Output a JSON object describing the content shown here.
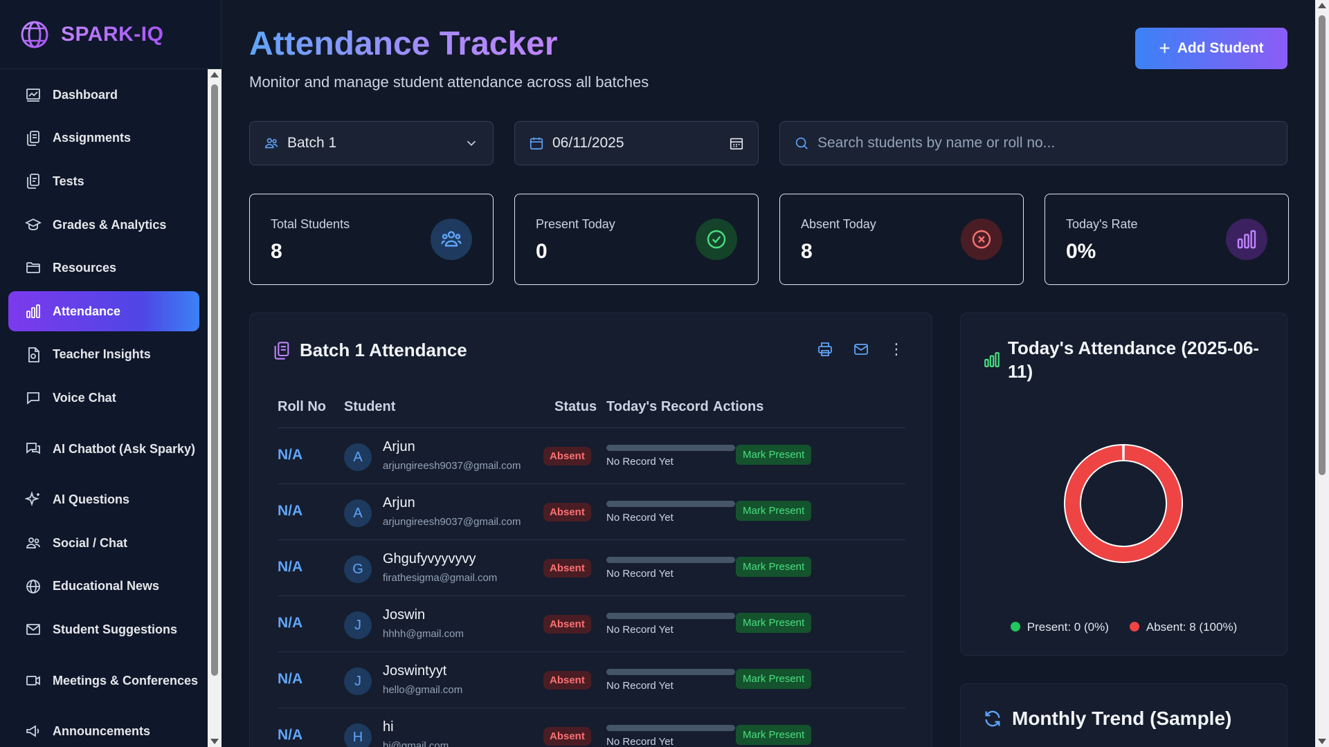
{
  "brand": {
    "name": "SPARK-IQ"
  },
  "sidebar": {
    "items": [
      {
        "label": "Dashboard",
        "icon": "dashboard-icon"
      },
      {
        "label": "Assignments",
        "icon": "assignments-icon"
      },
      {
        "label": "Tests",
        "icon": "tests-icon"
      },
      {
        "label": "Grades & Analytics",
        "icon": "graduation-cap-icon"
      },
      {
        "label": "Resources",
        "icon": "folder-icon"
      },
      {
        "label": "Attendance",
        "icon": "bar-chart-icon",
        "active": true
      },
      {
        "label": "Teacher Insights",
        "icon": "document-icon"
      },
      {
        "label": "Voice Chat",
        "icon": "chat-bubble-icon"
      },
      {
        "label": "AI Chatbot (Ask Sparky)",
        "icon": "chat-bubbles-icon"
      },
      {
        "label": "AI Questions",
        "icon": "sparkles-icon"
      },
      {
        "label": "Social / Chat",
        "icon": "users-icon"
      },
      {
        "label": "Educational News",
        "icon": "globe-icon"
      },
      {
        "label": "Student Suggestions",
        "icon": "mail-icon"
      },
      {
        "label": "Meetings & Conferences",
        "icon": "video-icon"
      },
      {
        "label": "Announcements",
        "icon": "megaphone-icon"
      }
    ]
  },
  "header": {
    "title": "Attendance Tracker",
    "subtitle": "Monitor and manage student attendance across all batches",
    "add_button": "Add Student"
  },
  "filters": {
    "batch": "Batch 1",
    "date": "06/11/2025",
    "search_placeholder": "Search students by name or roll no..."
  },
  "stats": [
    {
      "label": "Total Students",
      "value": "8",
      "icon": "users-icon",
      "color": "#60a5fa",
      "bg": "#1e3a5f"
    },
    {
      "label": "Present Today",
      "value": "0",
      "icon": "check-circle-icon",
      "color": "#4ade80",
      "bg": "#14432a"
    },
    {
      "label": "Absent Today",
      "value": "8",
      "icon": "x-circle-icon",
      "color": "#f87171",
      "bg": "#4a1d24"
    },
    {
      "label": "Today's Rate",
      "value": "0%",
      "icon": "bar-chart-icon",
      "color": "#c084fc",
      "bg": "#3b2160"
    }
  ],
  "table": {
    "title": "Batch 1 Attendance",
    "columns": [
      "Roll No",
      "Student",
      "Status",
      "Today's Record",
      "Actions"
    ],
    "rows": [
      {
        "roll": "N/A",
        "initial": "A",
        "name": "Arjun",
        "email": "arjungireesh9037@gmail.com",
        "status": "Absent",
        "record": "No Record Yet",
        "action": "Mark Present"
      },
      {
        "roll": "N/A",
        "initial": "A",
        "name": "Arjun",
        "email": "arjungireesh9037@gmail.com",
        "status": "Absent",
        "record": "No Record Yet",
        "action": "Mark Present"
      },
      {
        "roll": "N/A",
        "initial": "G",
        "name": "Ghgufyvyyvyvy",
        "email": "firathesigma@gmail.com",
        "status": "Absent",
        "record": "No Record Yet",
        "action": "Mark Present"
      },
      {
        "roll": "N/A",
        "initial": "J",
        "name": "Joswin",
        "email": "hhhh@gmail.com",
        "status": "Absent",
        "record": "No Record Yet",
        "action": "Mark Present"
      },
      {
        "roll": "N/A",
        "initial": "J",
        "name": "Joswintyyt",
        "email": "hello@gmail.com",
        "status": "Absent",
        "record": "No Record Yet",
        "action": "Mark Present"
      },
      {
        "roll": "N/A",
        "initial": "H",
        "name": "hi",
        "email": "hi@gmail.com",
        "status": "Absent",
        "record": "No Record Yet",
        "action": "Mark Present"
      }
    ]
  },
  "today_chart": {
    "title": "Today's Attendance (2025-06-11)",
    "legend_present": "Present: 0 (0%)",
    "legend_absent": "Absent: 8 (100%)",
    "present_color": "#22c55e",
    "absent_color": "#ef4444"
  },
  "chart_data": {
    "type": "pie",
    "title": "Today's Attendance (2025-06-11)",
    "categories": [
      "Present",
      "Absent"
    ],
    "values": [
      0,
      8
    ]
  },
  "monthly": {
    "title": "Monthly Trend (Sample)"
  }
}
